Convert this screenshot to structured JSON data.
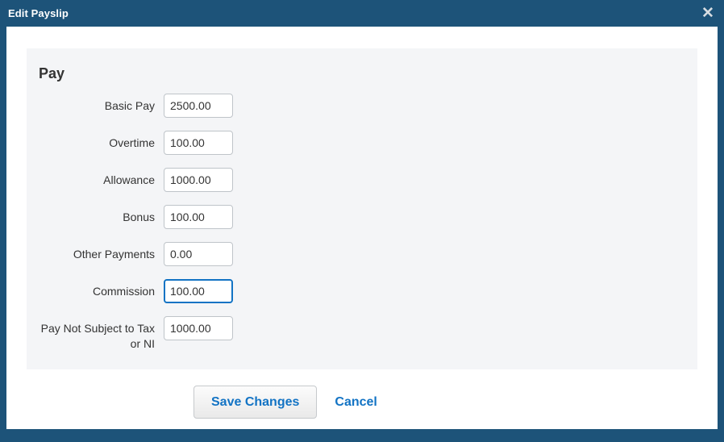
{
  "header": {
    "title": "Edit Payslip",
    "close_label": "✕",
    "background_color": "#1d5379"
  },
  "section": {
    "title": "Pay",
    "background_color": "#f4f5f7"
  },
  "fields": [
    {
      "label": "Basic Pay",
      "value": "2500.00",
      "name": "basic-pay",
      "focused": false
    },
    {
      "label": "Overtime",
      "value": "100.00",
      "name": "overtime",
      "focused": false
    },
    {
      "label": "Allowance",
      "value": "1000.00",
      "name": "allowance",
      "focused": false
    },
    {
      "label": "Bonus",
      "value": "100.00",
      "name": "bonus",
      "focused": false
    },
    {
      "label": "Other Payments",
      "value": "0.00",
      "name": "other-payments",
      "focused": false
    },
    {
      "label": "Commission",
      "value": "100.00",
      "name": "commission",
      "focused": true
    },
    {
      "label": "Pay Not Subject to Tax\nor NI",
      "value": "1000.00",
      "name": "pay-not-subject-to-tax-or-ni",
      "focused": false
    }
  ],
  "actions": {
    "save_label": "Save Changes",
    "cancel_label": "Cancel",
    "accent_color": "#1273c4"
  }
}
